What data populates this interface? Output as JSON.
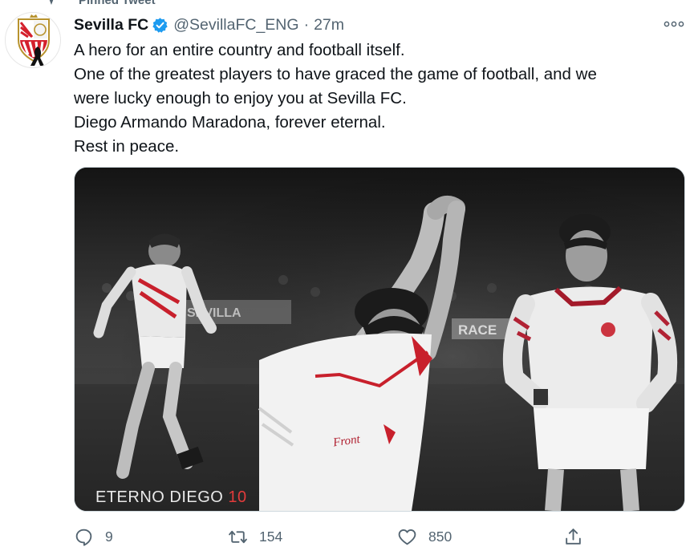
{
  "pinned": {
    "label": "Pinned Tweet"
  },
  "tweet": {
    "author_name": "Sevilla FC",
    "handle": "@SevillaFC_ENG",
    "separator": "·",
    "time": "27m",
    "verified": true,
    "lines": [
      "A hero for an entire country and football itself.",
      "One of the greatest players to have graced the game of football, and we",
      "were lucky enough to enjoy you at Sevilla FC.",
      "Diego Armando Maradona, forever eternal.",
      "Rest in peace."
    ]
  },
  "media": {
    "caption_main": "ETERNO DIEGO ",
    "caption_accent": "10",
    "shirt_text": "Front",
    "banner_text": "RACE",
    "stand_text": "SEVILLA"
  },
  "actions": {
    "reply_count": "9",
    "retweet_count": "154",
    "like_count": "850"
  },
  "colors": {
    "accent": "#1d9bf0",
    "secondary_text": "#536471",
    "sevilla_red": "#d4202c",
    "caption_red": "#e23b3b"
  },
  "icons": {
    "pin": "pin-icon",
    "verified": "verified-badge-icon",
    "more": "more-options-icon",
    "reply": "reply-icon",
    "retweet": "retweet-icon",
    "like": "heart-icon",
    "share": "share-icon"
  }
}
